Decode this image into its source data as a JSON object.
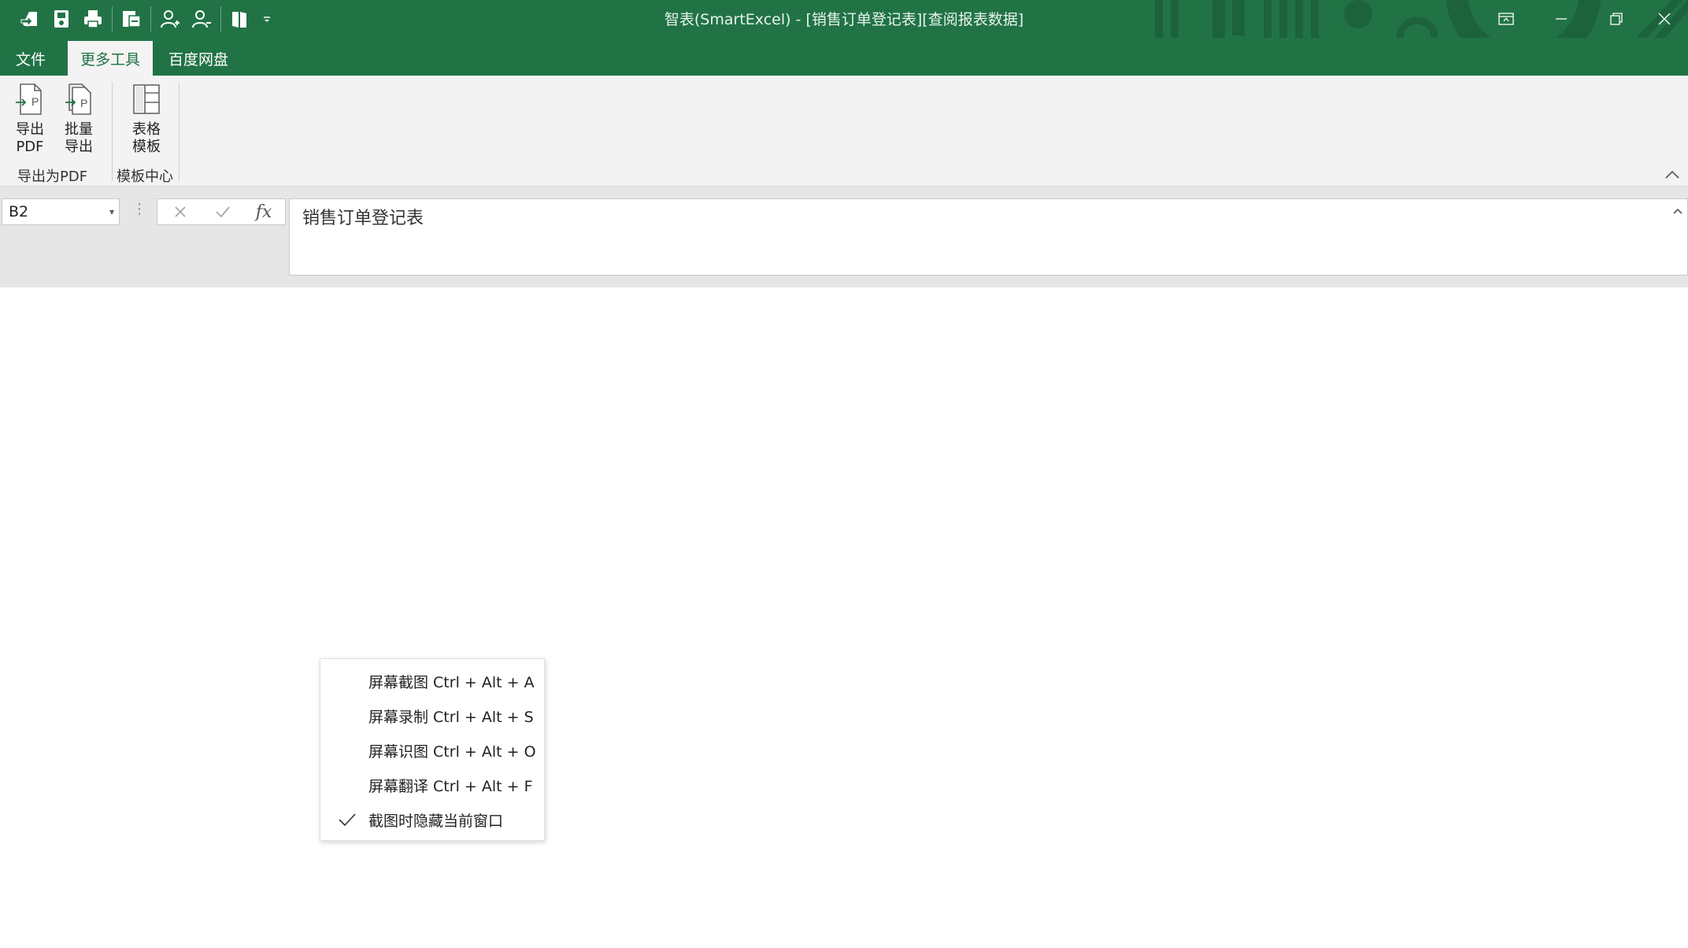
{
  "window": {
    "title": "智表(SmartExcel)  -  [销售订单登记表][查阅报表数据]",
    "brand_color": "#217346",
    "controls": [
      "ribbon-display-icon",
      "minimize-icon",
      "restore-icon",
      "close-icon"
    ]
  },
  "quick_access": {
    "icons": [
      "open-file-icon",
      "save-icon",
      "print-icon",
      "export-icon",
      "user-add-icon",
      "user-remove-icon",
      "book-icon",
      "customize-dropdown-icon"
    ]
  },
  "menu_tabs": [
    {
      "label": "文件",
      "active": false
    },
    {
      "label": "更多工具",
      "active": true
    },
    {
      "label": "百度网盘",
      "active": false
    }
  ],
  "ribbon": {
    "groups": [
      {
        "label": "导出为PDF",
        "buttons": [
          {
            "label_line1": "导出",
            "label_line2": "PDF",
            "icon": "export-pdf-icon"
          },
          {
            "label_line1": "批量",
            "label_line2": "导出",
            "icon": "batch-export-icon"
          }
        ]
      },
      {
        "label": "模板中心",
        "buttons": [
          {
            "label_line1": "表格",
            "label_line2": "模板",
            "icon": "table-template-icon"
          }
        ]
      }
    ]
  },
  "formula_bar": {
    "name_box": "B2",
    "formula": "销售订单登记表",
    "fx_label": "fx"
  },
  "context_menu": {
    "items": [
      {
        "label": "屏幕截图 Ctrl + Alt + A",
        "checked": false
      },
      {
        "label": "屏幕录制 Ctrl + Alt + S",
        "checked": false
      },
      {
        "label": "屏幕识图 Ctrl + Alt + O",
        "checked": false
      },
      {
        "label": "屏幕翻译 Ctrl + Alt + F",
        "checked": false
      },
      {
        "label": "截图时隐藏当前窗口",
        "checked": true
      }
    ]
  }
}
